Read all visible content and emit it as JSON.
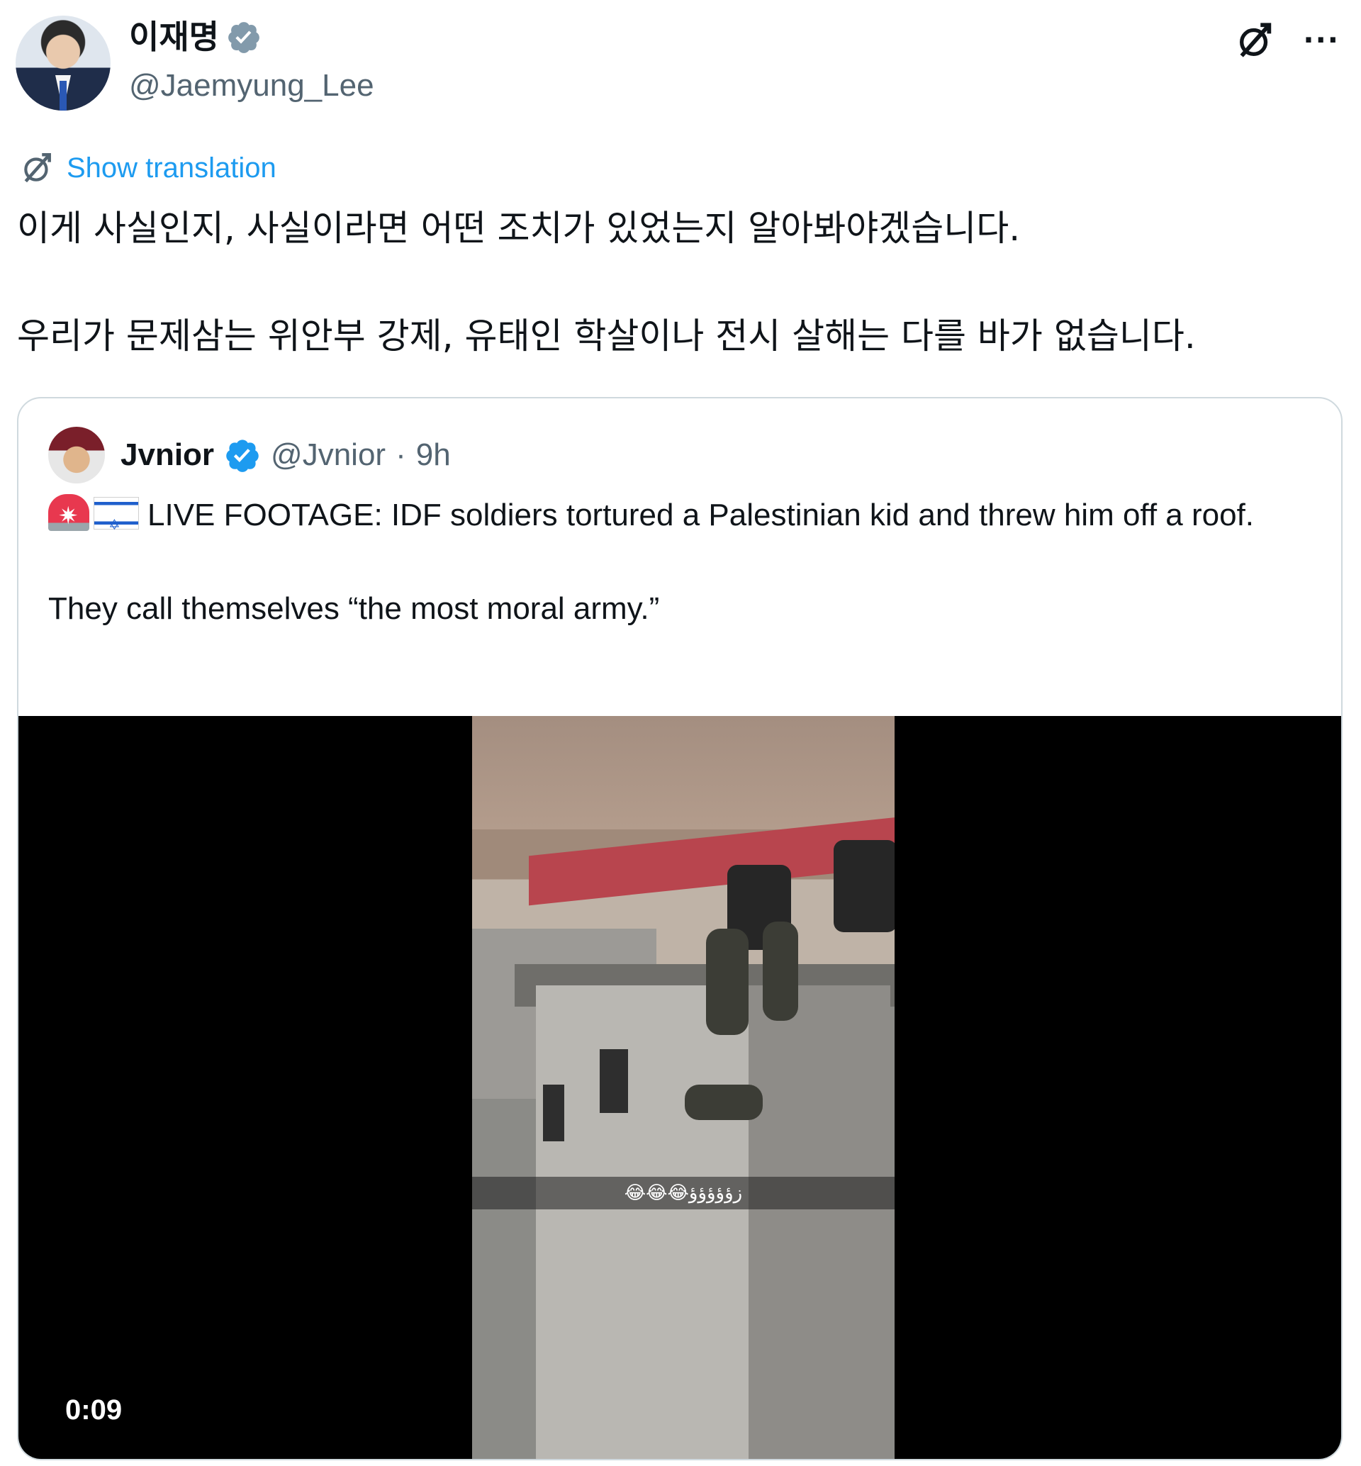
{
  "author": {
    "display_name": "이재명",
    "handle": "@Jaemyung_Lee",
    "verified_color": "#829aab"
  },
  "actions": {
    "grok_icon": "grok-icon",
    "more_label": "···"
  },
  "translation": {
    "link": "Show translation"
  },
  "tweet": {
    "line1": "이게 사실인지, 사실이라면 어떤 조치가 있었는지 알아봐야겠습니다.",
    "line2": "우리가 문제삼는 위안부 강제, 유태인 학살이나 전시 살해는 다를 바가 없습니다."
  },
  "quote": {
    "display_name": "Jvnior",
    "handle": "@Jvnior",
    "separator": "·",
    "time": "9h",
    "verified_color": "#1d9bf0",
    "text_line1": "LIVE FOOTAGE: IDF soldiers tortured a Palestinian kid and threw him off a roof.",
    "text_line2": "They call themselves “the most moral army.”",
    "emojis": [
      "siren-emoji",
      "israel-flag-emoji"
    ],
    "video": {
      "duration": "0:09",
      "caption": "😂😂😂زؤؤؤؤؤ"
    }
  },
  "colors": {
    "link": "#1d9bf0",
    "secondary_text": "#536471",
    "border": "#cfd9de"
  }
}
